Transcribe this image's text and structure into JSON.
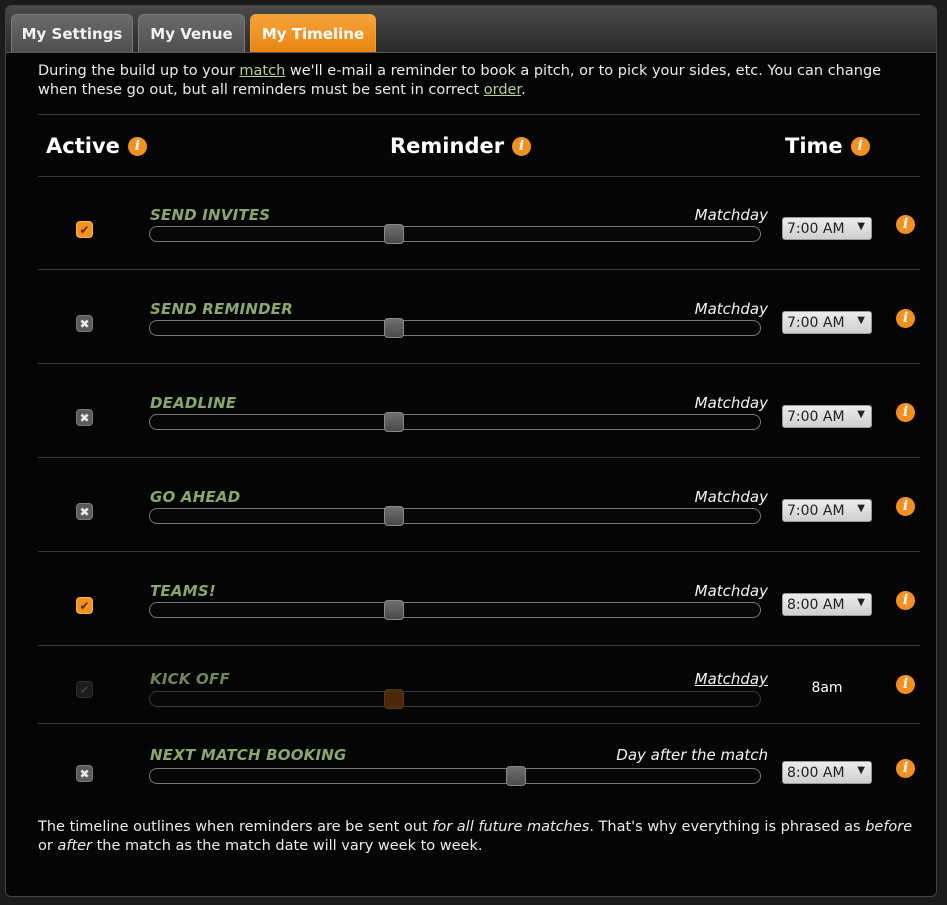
{
  "tabs": [
    {
      "label": "My Settings",
      "active": false
    },
    {
      "label": "My Venue",
      "active": false
    },
    {
      "label": "My Timeline",
      "active": true
    }
  ],
  "intro": {
    "part1": "During the build up to your ",
    "link1": "match",
    "part2": " we'll e-mail a reminder to book a pitch, or to pick your sides, etc. You can change when these go out, but all reminders must be sent in correct ",
    "link2": "order",
    "part3": "."
  },
  "headers": {
    "active": "Active",
    "reminder": "Reminder",
    "time": "Time",
    "info_glyph": "i"
  },
  "rows": [
    {
      "name": "SEND INVITES",
      "when": "Matchday",
      "active": "on",
      "time": "7:00 AM",
      "slider_fraction": 0.4,
      "disabled": false
    },
    {
      "name": "SEND REMINDER",
      "when": "Matchday",
      "active": "off",
      "time": "7:00 AM",
      "slider_fraction": 0.4,
      "disabled": false
    },
    {
      "name": "DEADLINE",
      "when": "Matchday",
      "active": "off",
      "time": "7:00 AM",
      "slider_fraction": 0.4,
      "disabled": false
    },
    {
      "name": "GO AHEAD",
      "when": "Matchday",
      "active": "off",
      "time": "7:00 AM",
      "slider_fraction": 0.4,
      "disabled": false
    },
    {
      "name": "TEAMS!",
      "when": "Matchday",
      "active": "on",
      "time": "8:00 AM",
      "slider_fraction": 0.4,
      "disabled": false
    },
    {
      "name": "KICK OFF",
      "when": "Matchday",
      "active": "disabled",
      "time": "8am",
      "slider_fraction": 0.4,
      "disabled": true
    },
    {
      "name": "NEXT MATCH BOOKING",
      "when": "Day after the match",
      "active": "off",
      "time": "8:00 AM",
      "slider_fraction": 0.6,
      "disabled": false
    }
  ],
  "footer": {
    "t1": "The timeline outlines when reminders are be sent out ",
    "t2": "for all future matches",
    "t3": ". That's why everything is phrased as ",
    "t4": "before",
    "t5": " or ",
    "t6": "after",
    "t7": " the match as the match date will vary week to week."
  },
  "colors": {
    "accent": "#f5901e",
    "reminder_name": "#8aa86a",
    "link": "#b7d18a"
  },
  "icons": {
    "checked": "✔",
    "unchecked": "✖",
    "dropdown": "▼"
  }
}
